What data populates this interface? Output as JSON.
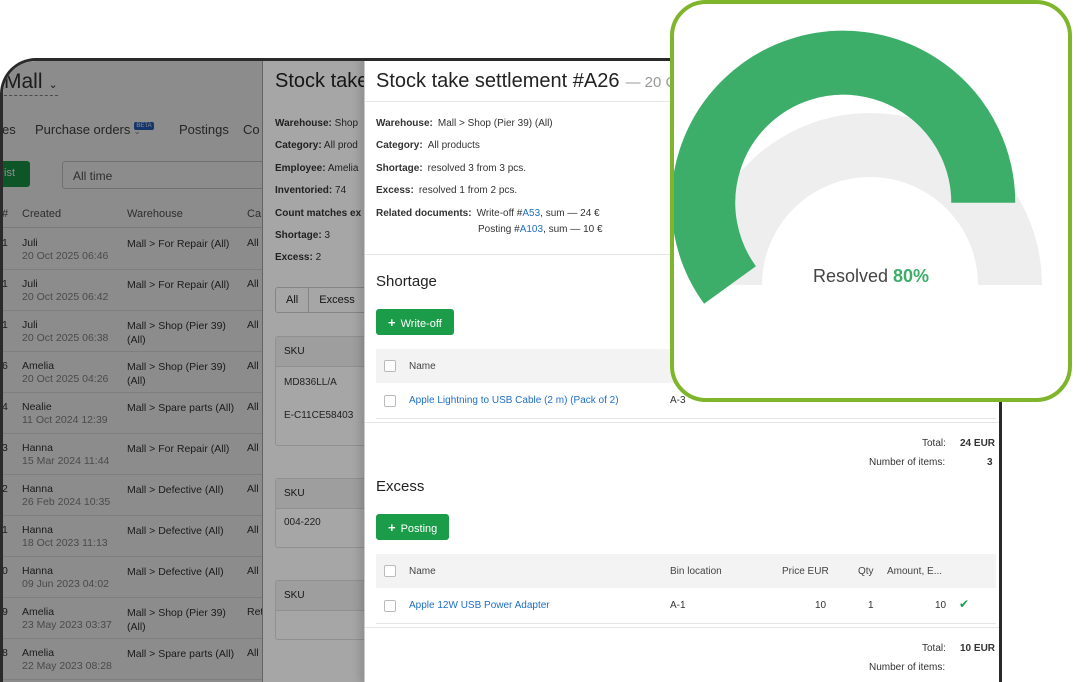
{
  "app": {
    "store_name": "Mall",
    "nav": [
      "es",
      "Purchase orders",
      "Postings",
      "Co"
    ],
    "nav_badge": "BETA",
    "list_button": "ist",
    "time_filter": "All time",
    "table_headers": [
      "#",
      "Created",
      "Warehouse",
      "Ca"
    ],
    "rows": [
      {
        "id": "1",
        "user": "Juli",
        "date": "20 Oct 2025 06:46",
        "warehouse": "Mall > For Repair (All)",
        "cat": "All"
      },
      {
        "id": "1",
        "user": "Juli",
        "date": "20 Oct 2025 06:42",
        "warehouse": "Mall > For Repair (All)",
        "cat": "All"
      },
      {
        "id": "1",
        "user": "Juli",
        "date": "20 Oct 2025 06:38",
        "warehouse": "Mall > Shop (Pier 39) (All)",
        "cat": "All"
      },
      {
        "id": "6",
        "user": "Amelia",
        "date": "20 Oct 2025 04:26",
        "warehouse": "Mall > Shop (Pier 39) (All)",
        "cat": "All"
      },
      {
        "id": "4",
        "user": "Nealie",
        "date": "11 Oct 2024 12:39",
        "warehouse": "Mall > Spare parts (All)",
        "cat": "All"
      },
      {
        "id": "3",
        "user": "Hanna",
        "date": "15 Mar 2024 11:44",
        "warehouse": "Mall > For Repair (All)",
        "cat": "All"
      },
      {
        "id": "2",
        "user": "Hanna",
        "date": "26 Feb 2024 10:35",
        "warehouse": "Mall > Defective (All)",
        "cat": "All"
      },
      {
        "id": "1",
        "user": "Hanna",
        "date": "18 Oct 2023 11:13",
        "warehouse": "Mall > Defective (All)",
        "cat": "All"
      },
      {
        "id": "0",
        "user": "Hanna",
        "date": "09 Jun 2023 04:02",
        "warehouse": "Mall > Defective (All)",
        "cat": "All"
      },
      {
        "id": "9",
        "user": "Amelia",
        "date": "23 May 2023 03:37",
        "warehouse": "Mall > Shop (Pier 39) (All)",
        "cat": "Ret"
      },
      {
        "id": "8",
        "user": "Amelia",
        "date": "22 May 2023 08:28",
        "warehouse": "Mall > Spare parts (All)",
        "cat": "All"
      }
    ]
  },
  "middle": {
    "title": "Stock take",
    "warehouse_label": "Warehouse:",
    "warehouse_value": "Shop",
    "category_label": "Category:",
    "category_value": "All prod",
    "employee_label": "Employee:",
    "employee_value": "Amelia",
    "inventoried_label": "Inventoried:",
    "inventoried_value": "74",
    "count_label": "Count matches ex",
    "shortage_label": "Shortage:",
    "shortage_value": "3",
    "excess_label": "Excess:",
    "excess_value": "2",
    "seg_all": "All",
    "seg_excess": "Excess",
    "box1_header": "SKU",
    "box1_rows": [
      "MD836LL/A",
      "E-C11CE58403"
    ],
    "box2_header": "SKU",
    "box2_rows": [
      "004-220"
    ],
    "box3_header": "SKU"
  },
  "front": {
    "title": "Stock take settlement #A26",
    "title_sub": "— 20 C",
    "warehouse_label": "Warehouse:",
    "warehouse_value": "Mall > Shop (Pier 39) (All)",
    "category_label": "Category:",
    "category_value": "All products",
    "shortage_label": "Shortage:",
    "shortage_value": "resolved 3 from 3 pcs.",
    "excess_label": "Excess:",
    "excess_value": "resolved 1 from 2 pcs.",
    "related_label": "Related documents:",
    "related_1_pre": "Write-off #",
    "related_1_link": "A53",
    "related_1_post": ", sum — 24 €",
    "related_2_pre": "Posting #",
    "related_2_link": "A103",
    "related_2_post": ", sum — 10 €",
    "shortage_heading": "Shortage",
    "writeoff_button": "Write-off",
    "shortage_table": {
      "col_name": "Name",
      "row_name": "Apple Lightning to USB Cable (2 m) (Pack of 2)",
      "row_bin": "A-3"
    },
    "shortage_total_label": "Total:",
    "shortage_total_value": "24 EUR",
    "shortage_items_label": "Number of items:",
    "shortage_items_value": "3",
    "excess_heading": "Excess",
    "posting_button": "Posting",
    "excess_table": {
      "col_name": "Name",
      "col_bin": "Bin location",
      "col_price": "Price EUR",
      "col_qty": "Qty",
      "col_amount": "Amount, E...",
      "row_name": "Apple 12W USB Power Adapter",
      "row_bin": "A-1",
      "row_price": "10",
      "row_qty": "1",
      "row_amount": "10"
    },
    "excess_total_label": "Total:",
    "excess_total_value": "10 EUR",
    "excess_items_label": "Number of items:"
  },
  "gauge": {
    "label": "Resolved",
    "value_text": "80%",
    "fraction": 0.8,
    "fill_color": "#3cae6a",
    "track_color": "#eeeeee",
    "border_color": "#7fb52b"
  }
}
